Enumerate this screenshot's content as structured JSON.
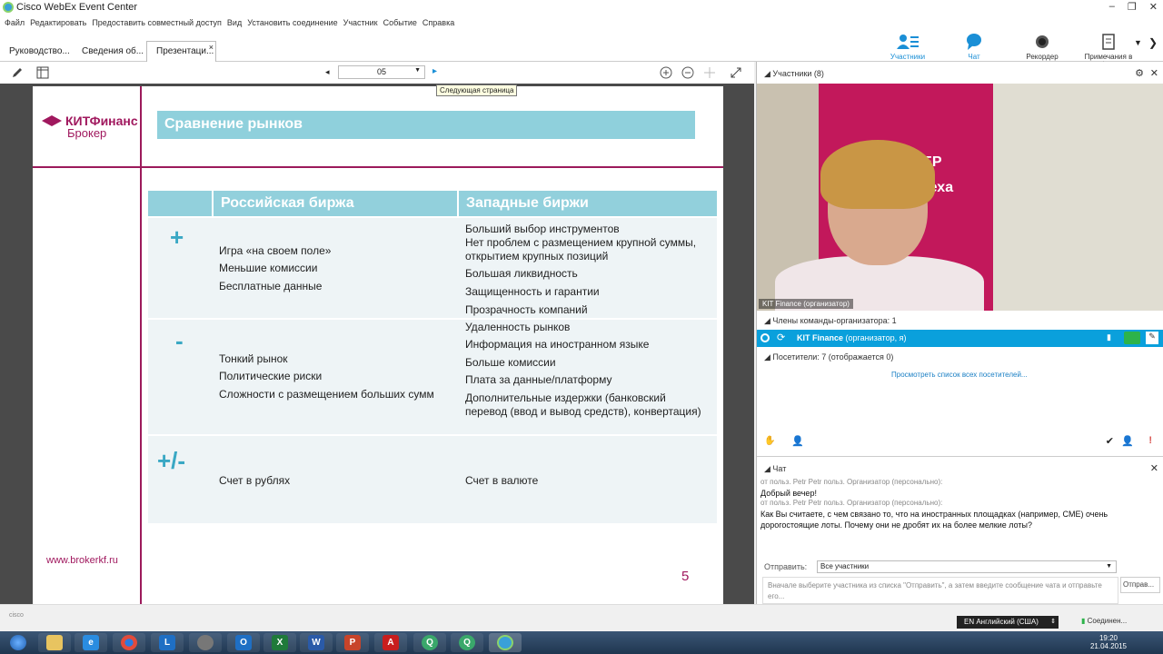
{
  "window": {
    "title": "Cisco WebEx Event Center",
    "controls": [
      "–",
      "❐",
      "✕"
    ]
  },
  "menu": [
    "Файл",
    "Редактировать",
    "Предоставить совместный доступ",
    "Вид",
    "Установить соединение",
    "Участник",
    "Событие",
    "Справка"
  ],
  "tabs": [
    {
      "label": "Руководство..."
    },
    {
      "label": "Сведения об..."
    },
    {
      "label": "Презентаци..."
    }
  ],
  "top_buttons": [
    {
      "label": "Участники",
      "icon": "participants-icon"
    },
    {
      "label": "Чат",
      "icon": "chat-icon"
    },
    {
      "label": "Рекордер",
      "icon": "recorder-icon"
    },
    {
      "label": "Примечания в фо...",
      "icon": "notes-icon"
    }
  ],
  "doc_toolbar": {
    "page_value": "05",
    "tooltip": "Следующая страница"
  },
  "slide": {
    "logo_line1": "КИТФинанс",
    "logo_line2": "Брокер",
    "title": "Сравнение рынков",
    "col_russian": "Российская биржа",
    "col_western": "Западные биржи",
    "rows": [
      {
        "sign": "+",
        "russian": [
          "Игра «на своем поле»",
          "Меньшие комиссии",
          "Бесплатные данные"
        ],
        "western": [
          "Больший выбор инструментов",
          "Нет проблем с размещением крупной суммы, открытием крупных позиций",
          "Большая ликвидность",
          "Защищенность и гарантии",
          "Прозрачность компаний"
        ]
      },
      {
        "sign": "-",
        "russian": [
          "Тонкий рынок",
          "Политические риски",
          "Сложности с размещением больших сумм"
        ],
        "western": [
          "Удаленность рынков",
          "Информация на иностранном языке",
          "Больше комиссии",
          "Плата за данные/платформу",
          "Дополнительные издержки (банковский перевод (ввод и вывод средств), конвертация)"
        ]
      },
      {
        "sign": "+/-",
        "russian": [
          "Счет в рублях"
        ],
        "western": [
          "Счет в валюте"
        ]
      }
    ],
    "url": "www.brokerkf.ru",
    "page_number": "5"
  },
  "participants": {
    "header": "Участники (8)",
    "video_caption": "KIT Finance (организатор)",
    "video_poster_text1": "БРОКЕР",
    "video_poster_text2": "плеха",
    "host_group": "Члены команды-организатора: 1",
    "host_name": "KIT Finance",
    "host_role": "(организатор, я)",
    "attendees": "Посетители: 7 (отображается 0)",
    "view_all_link": "Просмотреть список всех посетителей..."
  },
  "chat": {
    "header": "Чат",
    "messages": [
      {
        "meta": "от польз. Petr Petr польз. Организатор (персонально):",
        "text": "Добрый вечер!"
      },
      {
        "meta": "от польз. Petr Petr польз. Организатор (персонально):",
        "text": "Как Вы считаете, с чем связано то, что на иностранных площадках (например, CME) очень дорогостоящие лоты. Почему они не дробят их на более мелкие лоты?"
      }
    ],
    "send_label": "Отправить:",
    "send_to": "Все участники",
    "input_placeholder": "Вначале выберите участника из списка \"Отправить\", а затем введите сообщение чата и отправьте его...",
    "send_button": "Отправ..."
  },
  "status": {
    "language": "EN Английский (США)",
    "connection": "Соединен..."
  },
  "taskbar": {
    "time": "19:20",
    "date": "21.04.2015"
  },
  "colors": {
    "brand": "#a0185e",
    "accent": "#0aa0dc",
    "table_header": "#92d0dc"
  }
}
